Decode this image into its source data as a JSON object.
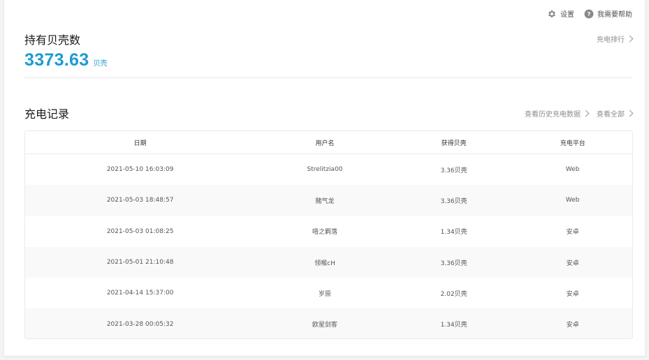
{
  "top_actions": {
    "settings_label": "设置",
    "help_label": "我需要帮助"
  },
  "balance_section": {
    "title": "持有贝壳数",
    "value": "3373.63",
    "unit": "贝壳",
    "ranking_link": "充电排行"
  },
  "records_section": {
    "title": "充电记录",
    "history_link": "查看历史充电数据",
    "view_all_link": "查看全部",
    "columns": [
      "日期",
      "用户名",
      "获得贝壳",
      "充电平台"
    ],
    "rows": [
      {
        "date": "2021-05-10 16:03:09",
        "user": "Strelitzia00",
        "shells": "3.36贝壳",
        "platform": "Web"
      },
      {
        "date": "2021-05-03 18:48:57",
        "user": "賭气龙",
        "shells": "3.36贝壳",
        "platform": "Web"
      },
      {
        "date": "2021-05-03 01:08:25",
        "user": "唔之羁落",
        "shells": "1.34贝壳",
        "platform": "安卓"
      },
      {
        "date": "2021-05-01 21:10:48",
        "user": "领喉cH",
        "shells": "3.36贝壳",
        "platform": "安卓"
      },
      {
        "date": "2021-04-14 15:37:00",
        "user": "岁原",
        "shells": "2.02贝壳",
        "platform": "安卓"
      },
      {
        "date": "2021-03-28 00:05:32",
        "user": "欧星剑客",
        "shells": "1.34贝壳",
        "platform": "安卓"
      }
    ]
  },
  "colors": {
    "accent": "#1e9bd0",
    "icon_gray": "#8a8a8a"
  }
}
